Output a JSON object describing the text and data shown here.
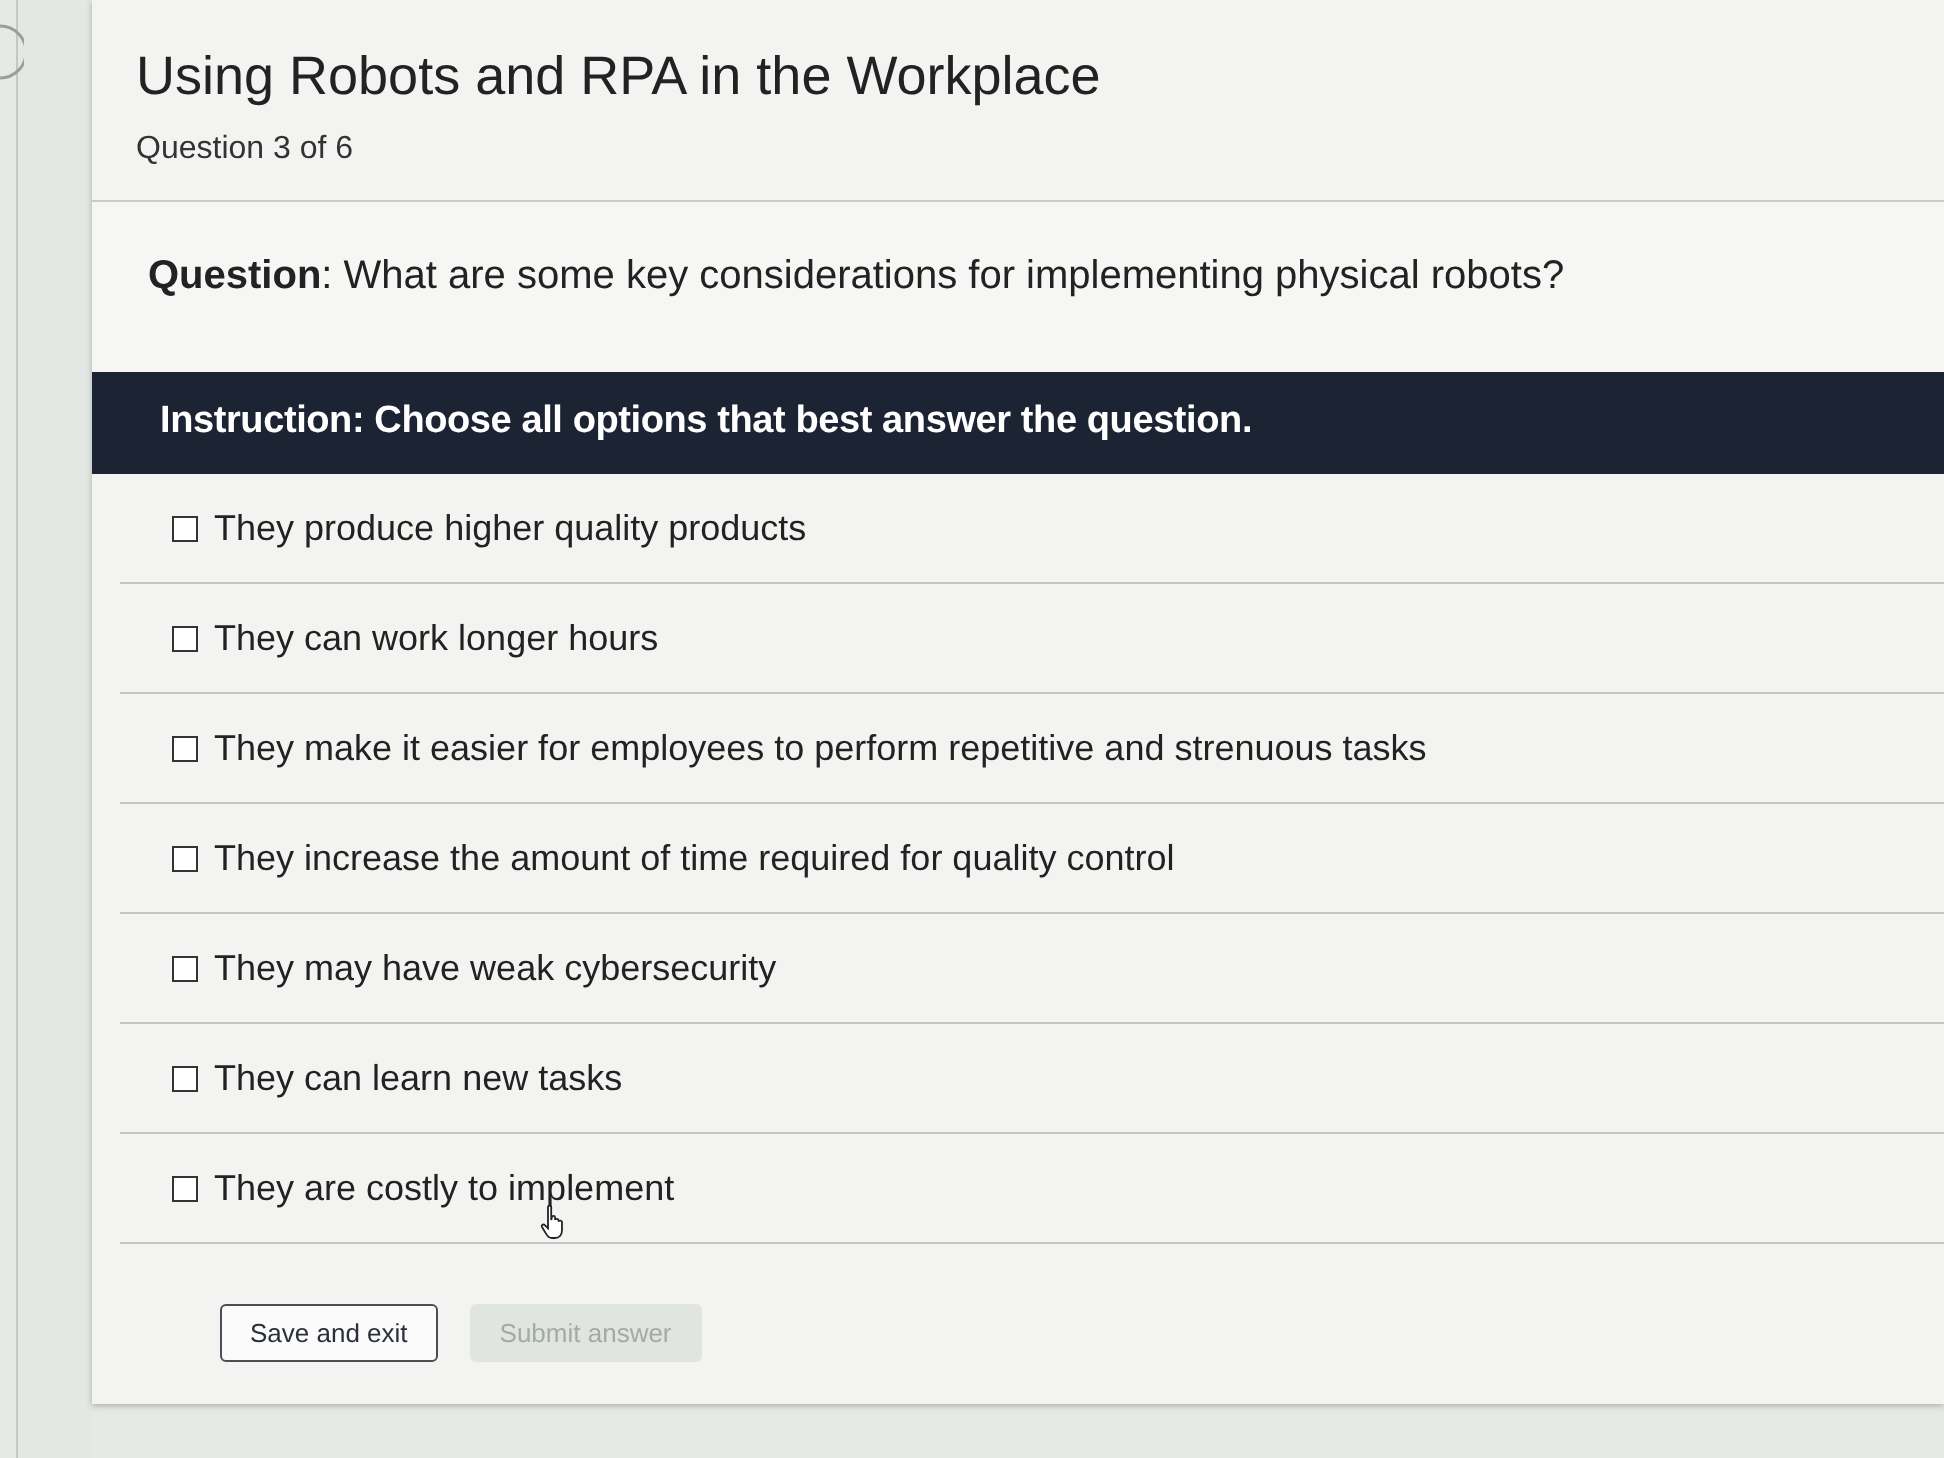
{
  "header": {
    "title": "Using Robots and RPA in the Workplace",
    "progress": "Question 3 of 6"
  },
  "question": "**Question**: What are some key considerations for implementing physical robots?",
  "instruction": "Instruction: Choose all options that best answer the question.",
  "options": [
    {
      "label": "They produce higher quality products",
      "checked": false
    },
    {
      "label": "They can work longer hours",
      "checked": false
    },
    {
      "label": "They make it easier for employees to perform repetitive and strenuous tasks",
      "checked": false
    },
    {
      "label": "They increase the amount of time required for quality control",
      "checked": false
    },
    {
      "label": "They may have weak cybersecurity",
      "checked": false
    },
    {
      "label": "They can learn new tasks",
      "checked": false
    },
    {
      "label": "They are costly to implement",
      "checked": false
    }
  ],
  "buttons": [
    {
      "label": "Save and exit",
      "disabled": false
    },
    {
      "label": "Submit answer",
      "disabled": true
    }
  ]
}
